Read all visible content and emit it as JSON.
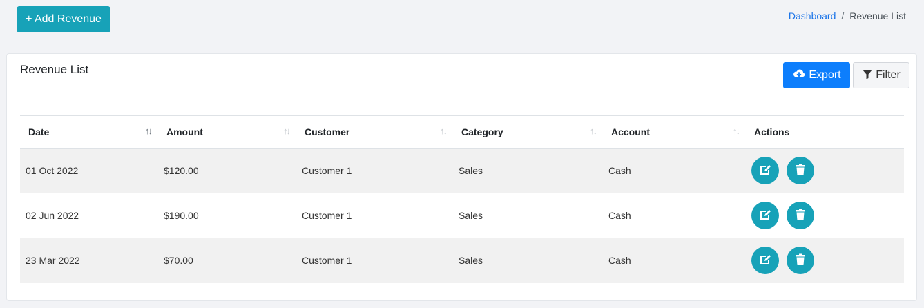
{
  "toolbar": {
    "add_label": "+ Add Revenue"
  },
  "breadcrumb": {
    "home": "Dashboard",
    "separator": "/",
    "current": "Revenue List"
  },
  "card": {
    "title": "Revenue List",
    "export_label": "Export",
    "filter_label": "Filter"
  },
  "table": {
    "columns": [
      "Date",
      "Amount",
      "Customer",
      "Category",
      "Account",
      "Actions"
    ],
    "rows": [
      {
        "date": "01 Oct 2022",
        "amount": "$120.00",
        "customer": "Customer 1",
        "category": "Sales",
        "account": "Cash"
      },
      {
        "date": "02 Jun 2022",
        "amount": "$190.00",
        "customer": "Customer 1",
        "category": "Sales",
        "account": "Cash"
      },
      {
        "date": "23 Mar 2022",
        "amount": "$70.00",
        "customer": "Customer 1",
        "category": "Sales",
        "account": "Cash"
      }
    ]
  },
  "colors": {
    "accent": "#17a2b8",
    "primary": "#0d7efc",
    "link": "#1a73e8"
  },
  "icons": {
    "export": "cloud-download-icon",
    "filter": "filter-icon",
    "edit": "edit-icon",
    "delete": "trash-icon",
    "sort": "sort-icon"
  }
}
